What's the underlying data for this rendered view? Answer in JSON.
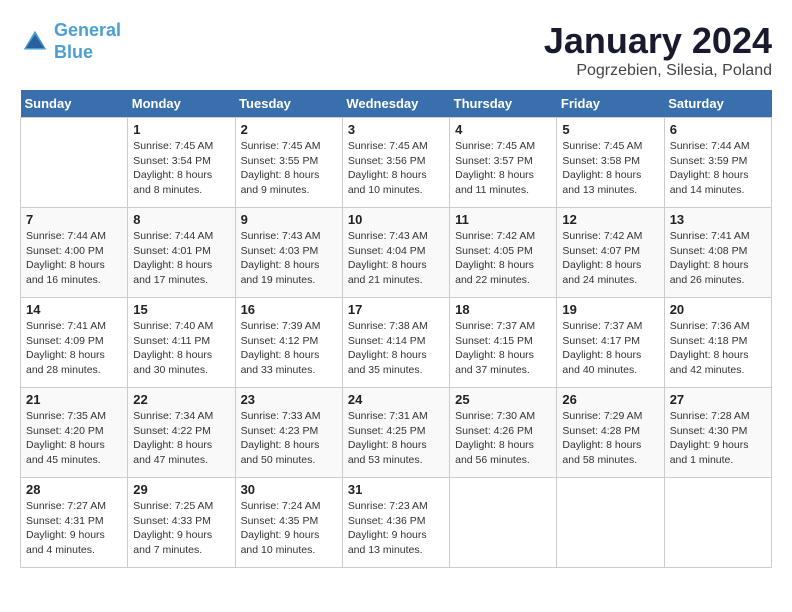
{
  "logo": {
    "line1": "General",
    "line2": "Blue"
  },
  "title": "January 2024",
  "subtitle": "Pogrzebien, Silesia, Poland",
  "headers": [
    "Sunday",
    "Monday",
    "Tuesday",
    "Wednesday",
    "Thursday",
    "Friday",
    "Saturday"
  ],
  "weeks": [
    [
      {
        "day": "",
        "info": ""
      },
      {
        "day": "1",
        "info": "Sunrise: 7:45 AM\nSunset: 3:54 PM\nDaylight: 8 hours\nand 8 minutes."
      },
      {
        "day": "2",
        "info": "Sunrise: 7:45 AM\nSunset: 3:55 PM\nDaylight: 8 hours\nand 9 minutes."
      },
      {
        "day": "3",
        "info": "Sunrise: 7:45 AM\nSunset: 3:56 PM\nDaylight: 8 hours\nand 10 minutes."
      },
      {
        "day": "4",
        "info": "Sunrise: 7:45 AM\nSunset: 3:57 PM\nDaylight: 8 hours\nand 11 minutes."
      },
      {
        "day": "5",
        "info": "Sunrise: 7:45 AM\nSunset: 3:58 PM\nDaylight: 8 hours\nand 13 minutes."
      },
      {
        "day": "6",
        "info": "Sunrise: 7:44 AM\nSunset: 3:59 PM\nDaylight: 8 hours\nand 14 minutes."
      }
    ],
    [
      {
        "day": "7",
        "info": "Sunrise: 7:44 AM\nSunset: 4:00 PM\nDaylight: 8 hours\nand 16 minutes."
      },
      {
        "day": "8",
        "info": "Sunrise: 7:44 AM\nSunset: 4:01 PM\nDaylight: 8 hours\nand 17 minutes."
      },
      {
        "day": "9",
        "info": "Sunrise: 7:43 AM\nSunset: 4:03 PM\nDaylight: 8 hours\nand 19 minutes."
      },
      {
        "day": "10",
        "info": "Sunrise: 7:43 AM\nSunset: 4:04 PM\nDaylight: 8 hours\nand 21 minutes."
      },
      {
        "day": "11",
        "info": "Sunrise: 7:42 AM\nSunset: 4:05 PM\nDaylight: 8 hours\nand 22 minutes."
      },
      {
        "day": "12",
        "info": "Sunrise: 7:42 AM\nSunset: 4:07 PM\nDaylight: 8 hours\nand 24 minutes."
      },
      {
        "day": "13",
        "info": "Sunrise: 7:41 AM\nSunset: 4:08 PM\nDaylight: 8 hours\nand 26 minutes."
      }
    ],
    [
      {
        "day": "14",
        "info": "Sunrise: 7:41 AM\nSunset: 4:09 PM\nDaylight: 8 hours\nand 28 minutes."
      },
      {
        "day": "15",
        "info": "Sunrise: 7:40 AM\nSunset: 4:11 PM\nDaylight: 8 hours\nand 30 minutes."
      },
      {
        "day": "16",
        "info": "Sunrise: 7:39 AM\nSunset: 4:12 PM\nDaylight: 8 hours\nand 33 minutes."
      },
      {
        "day": "17",
        "info": "Sunrise: 7:38 AM\nSunset: 4:14 PM\nDaylight: 8 hours\nand 35 minutes."
      },
      {
        "day": "18",
        "info": "Sunrise: 7:37 AM\nSunset: 4:15 PM\nDaylight: 8 hours\nand 37 minutes."
      },
      {
        "day": "19",
        "info": "Sunrise: 7:37 AM\nSunset: 4:17 PM\nDaylight: 8 hours\nand 40 minutes."
      },
      {
        "day": "20",
        "info": "Sunrise: 7:36 AM\nSunset: 4:18 PM\nDaylight: 8 hours\nand 42 minutes."
      }
    ],
    [
      {
        "day": "21",
        "info": "Sunrise: 7:35 AM\nSunset: 4:20 PM\nDaylight: 8 hours\nand 45 minutes."
      },
      {
        "day": "22",
        "info": "Sunrise: 7:34 AM\nSunset: 4:22 PM\nDaylight: 8 hours\nand 47 minutes."
      },
      {
        "day": "23",
        "info": "Sunrise: 7:33 AM\nSunset: 4:23 PM\nDaylight: 8 hours\nand 50 minutes."
      },
      {
        "day": "24",
        "info": "Sunrise: 7:31 AM\nSunset: 4:25 PM\nDaylight: 8 hours\nand 53 minutes."
      },
      {
        "day": "25",
        "info": "Sunrise: 7:30 AM\nSunset: 4:26 PM\nDaylight: 8 hours\nand 56 minutes."
      },
      {
        "day": "26",
        "info": "Sunrise: 7:29 AM\nSunset: 4:28 PM\nDaylight: 8 hours\nand 58 minutes."
      },
      {
        "day": "27",
        "info": "Sunrise: 7:28 AM\nSunset: 4:30 PM\nDaylight: 9 hours\nand 1 minute."
      }
    ],
    [
      {
        "day": "28",
        "info": "Sunrise: 7:27 AM\nSunset: 4:31 PM\nDaylight: 9 hours\nand 4 minutes."
      },
      {
        "day": "29",
        "info": "Sunrise: 7:25 AM\nSunset: 4:33 PM\nDaylight: 9 hours\nand 7 minutes."
      },
      {
        "day": "30",
        "info": "Sunrise: 7:24 AM\nSunset: 4:35 PM\nDaylight: 9 hours\nand 10 minutes."
      },
      {
        "day": "31",
        "info": "Sunrise: 7:23 AM\nSunset: 4:36 PM\nDaylight: 9 hours\nand 13 minutes."
      },
      {
        "day": "",
        "info": ""
      },
      {
        "day": "",
        "info": ""
      },
      {
        "day": "",
        "info": ""
      }
    ]
  ]
}
